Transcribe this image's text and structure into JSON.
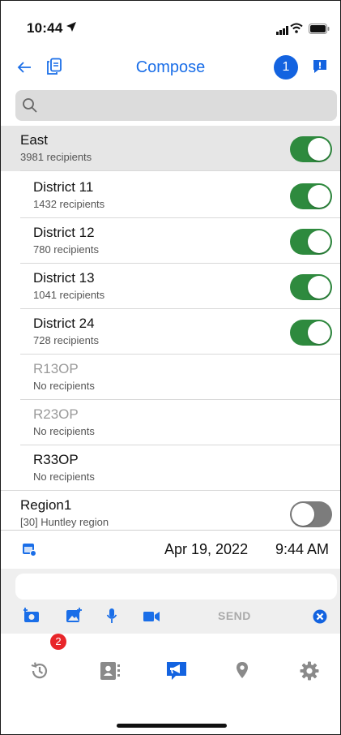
{
  "status": {
    "time": "10:44"
  },
  "header": {
    "title": "Compose",
    "badge_count": "1"
  },
  "search": {
    "placeholder": "",
    "value": ""
  },
  "groups": [
    {
      "name": "East",
      "sub": "3981 recipients",
      "toggle": "on",
      "level": 0,
      "disabled": false
    },
    {
      "name": "District 11",
      "sub": "1432 recipients",
      "toggle": "on",
      "level": 1,
      "disabled": false
    },
    {
      "name": "District 12",
      "sub": "780 recipients",
      "toggle": "on",
      "level": 1,
      "disabled": false
    },
    {
      "name": "District 13",
      "sub": "1041 recipients",
      "toggle": "on",
      "level": 1,
      "disabled": false
    },
    {
      "name": "District 24",
      "sub": "728 recipients",
      "toggle": "on",
      "level": 1,
      "disabled": false
    },
    {
      "name": "R13OP",
      "sub": "No recipients",
      "toggle": "none",
      "level": 1,
      "disabled": true
    },
    {
      "name": "R23OP",
      "sub": "No recipients",
      "toggle": "none",
      "level": 1,
      "disabled": true
    },
    {
      "name": "R33OP",
      "sub": "No recipients",
      "toggle": "none",
      "level": 1,
      "disabled": false
    },
    {
      "name": "Region1",
      "sub": "[30] Huntley region",
      "toggle": "off",
      "level": 0,
      "disabled": false
    }
  ],
  "schedule": {
    "date": "Apr 19, 2022",
    "time": "9:44 AM"
  },
  "compose": {
    "placeholder": "",
    "send_label": "SEND"
  },
  "tabbar": {
    "history_badge": "2",
    "active": "compose"
  },
  "colors": {
    "accent": "#1a6ee8",
    "toggle_on": "#2e8a3e",
    "toggle_off": "#7c7c7c",
    "badge_red": "#e8262a"
  },
  "icons": [
    "location-arrow-icon",
    "signal-icon",
    "wifi-icon",
    "battery-icon",
    "back-arrow-icon",
    "copy-icon",
    "message-alert-icon",
    "search-icon",
    "calendar-clock-icon",
    "add-camera-icon",
    "add-image-icon",
    "microphone-icon",
    "video-icon",
    "cancel-icon",
    "history-icon",
    "contacts-icon",
    "megaphone-icon",
    "map-pin-icon",
    "gear-icon"
  ]
}
